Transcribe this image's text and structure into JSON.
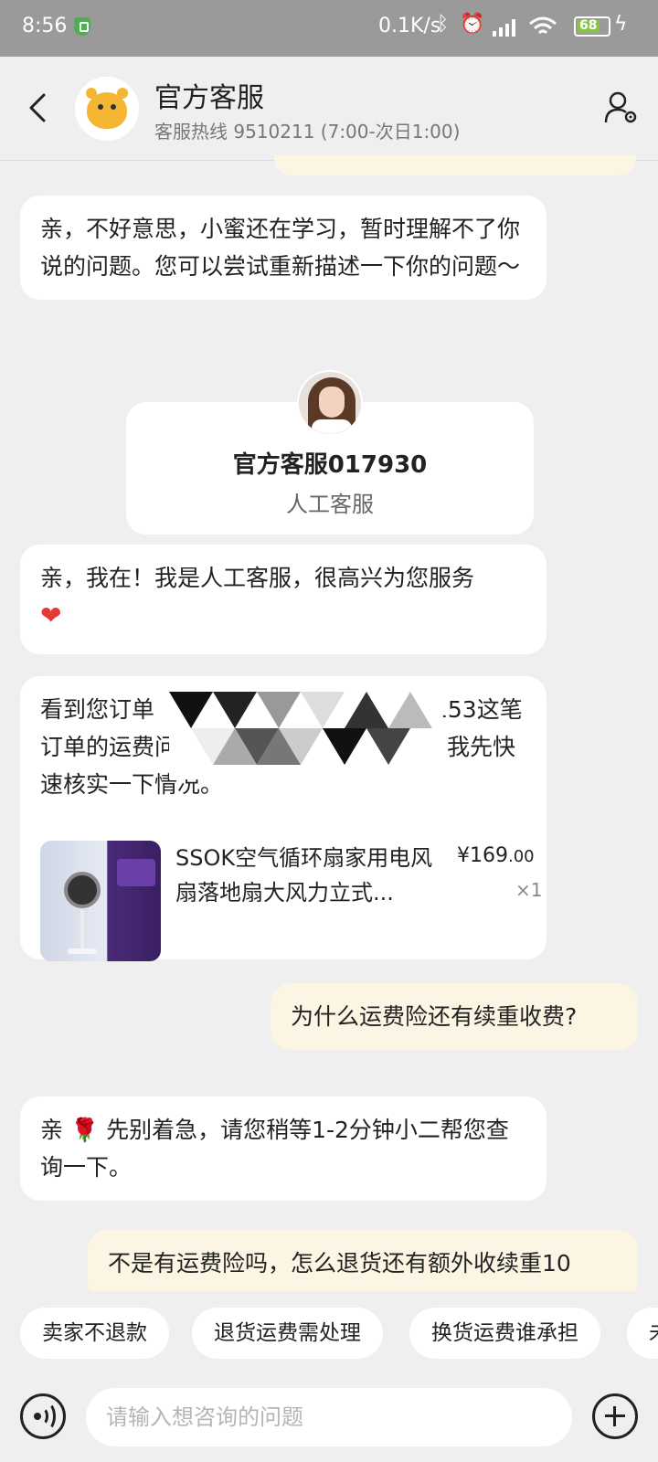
{
  "status_bar": {
    "time": "8:56",
    "speed": "0.1K/s",
    "battery": "68",
    "icons": [
      "shield-icon",
      "bluetooth-icon",
      "alarm-icon",
      "hd-signal-icon",
      "wifi-icon",
      "battery-icon",
      "charging-icon"
    ]
  },
  "header": {
    "title": "官方客服",
    "subtitle": "客服热线 9510211 (7:00-次日1:00)"
  },
  "messages": {
    "m1": "亲，不好意思，小蜜还在学习，暂时理解不了你说的问题。您可以尝试重新描述一下你的问题～",
    "agent_name": "官方客服017930",
    "agent_role": "人工客服",
    "m2": "亲，我在！我是人工客服，很高兴为您服务",
    "m3_line1_start": "看到您订单",
    "m3_line1_end": "153这笔",
    "m3_line2_start": "订单的运费问",
    "m3_line2_end": "，我先快",
    "m3_line3": "速核实一下情况。",
    "product_name": "SSOK空气循环扇家用电风扇落地扇大风力立式...",
    "product_price": "¥169",
    "product_price_dec": ".00",
    "product_qty": "×1",
    "m4": "为什么运费险还有续重收费?",
    "m5_prefix": "亲",
    "m5_emoji": "🌹",
    "m5_rest": "先别着急，请您稍等1-2分钟小二帮您查询一下。",
    "m6": "不是有运费险吗，怎么退货还有额外收续重10"
  },
  "quick_replies": [
    "卖家不退款",
    "退货运费需处理",
    "换货运费谁承担",
    "未"
  ],
  "input": {
    "placeholder": "请输入想咨询的问题"
  },
  "colors": {
    "background": "#efefef",
    "my_bubble": "#fdf5e4",
    "their_bubble": "#ffffff"
  }
}
